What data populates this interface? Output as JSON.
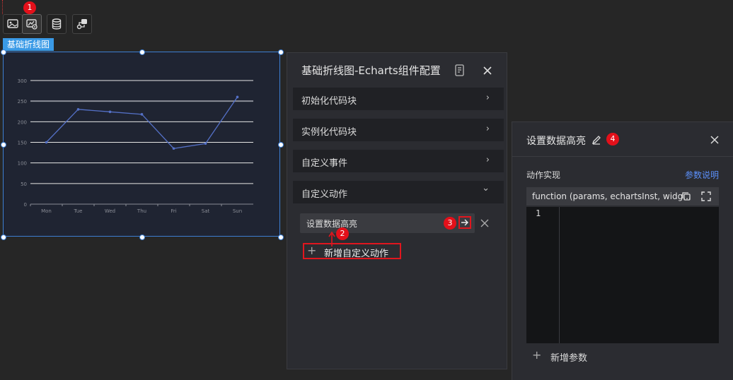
{
  "toolbar": {
    "buttons": [
      {
        "icon": "image-icon"
      },
      {
        "icon": "chart-config-icon"
      },
      {
        "icon": "database-icon"
      },
      {
        "icon": "interaction-icon"
      }
    ],
    "step1": "1"
  },
  "widget": {
    "tag": "基础折线图",
    "chart_data": {
      "type": "line",
      "categories": [
        "Mon",
        "Tue",
        "Wed",
        "Thu",
        "Fri",
        "Sat",
        "Sun"
      ],
      "values": [
        150,
        230,
        224,
        218,
        135,
        147,
        260
      ],
      "ylim": [
        0,
        300
      ],
      "yticks": [
        "0",
        "50",
        "100",
        "150",
        "200",
        "250",
        "300"
      ],
      "grid": true,
      "line_color": "#5470c6"
    }
  },
  "config_panel": {
    "title": "基础折线图-Echarts组件配置",
    "sections": [
      {
        "label": "初始化代码块",
        "chevron": "›"
      },
      {
        "label": "实例化代码块",
        "chevron": "›"
      },
      {
        "label": "自定义事件",
        "chevron": "›"
      },
      {
        "label": "自定义动作",
        "chevron": "⌄"
      }
    ],
    "action_item": "设置数据高亮",
    "add_action": "新增自定义动作",
    "step2": "2",
    "step3": "3"
  },
  "action_panel": {
    "title": "设置数据高亮",
    "step4": "4",
    "impl_label": "动作实现",
    "param_help": "参数说明",
    "code_header": "function (params, echartsInst, widg...",
    "line_number": "1",
    "add_param": "新增参数"
  },
  "colors": {
    "accent": "#3a9ae6",
    "badge": "#e3101a",
    "highlight": "#e0161e",
    "link": "#5b8ff9"
  }
}
